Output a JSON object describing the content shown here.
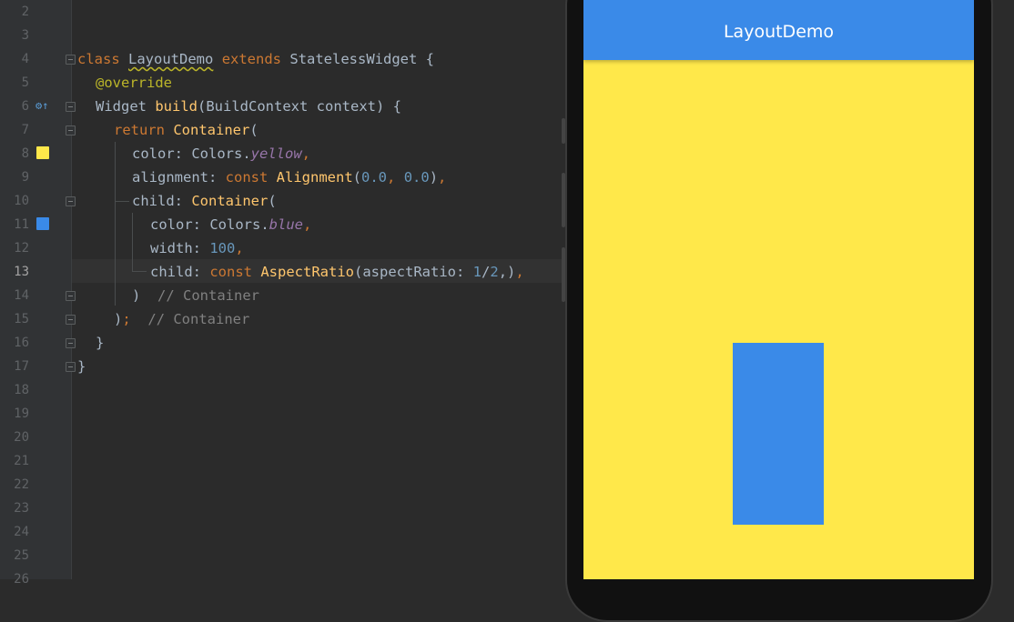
{
  "editor": {
    "line_numbers": [
      "2",
      "3",
      "4",
      "5",
      "6",
      "7",
      "8",
      "9",
      "10",
      "11",
      "12",
      "13",
      "14",
      "15",
      "16",
      "17",
      "18",
      "19",
      "20",
      "21",
      "22",
      "23",
      "24",
      "25",
      "26"
    ],
    "current_line": "13",
    "code": {
      "l4": {
        "kw_class": "class",
        "name": "LayoutDemo",
        "kw_extends": "extends",
        "base": "StatelessWidget",
        "brace": " {"
      },
      "l5": {
        "at": "@",
        "ann": "override"
      },
      "l6": {
        "type": "Widget",
        "method": "build",
        "params": "(BuildContext context) {"
      },
      "l7": {
        "kw_return": "return",
        "ctor": "Container",
        "paren": "("
      },
      "l8": {
        "prop": "color: Colors.",
        "value": "yellow",
        "comma": ","
      },
      "l9": {
        "prop": "alignment: ",
        "kw_const": "const",
        "ctor": "Alignment",
        "open": "(",
        "a": "0.0",
        "sep": ", ",
        "b": "0.0",
        "close": ")",
        "comma": ","
      },
      "l10": {
        "prop": "child: ",
        "ctor": "Container",
        "paren": "("
      },
      "l11": {
        "prop": "color: Colors.",
        "value": "blue",
        "comma": ","
      },
      "l12": {
        "prop": "width: ",
        "value": "100",
        "comma": ","
      },
      "l13": {
        "prop": "child: ",
        "kw_const": "const",
        "ctor": "AspectRatio",
        "open": "(aspectRatio: ",
        "a": "1",
        "slash": "/",
        "b": "2",
        "close": ",)",
        "comma": ","
      },
      "l14": {
        "close": ")",
        "comment": "// Container"
      },
      "l15": {
        "close": ")",
        "semi": ";",
        "comment": "// Container"
      },
      "l16": {
        "close": "}"
      },
      "l17": {
        "close": "}"
      }
    },
    "swatches": {
      "yellow": "#ffe84a",
      "blue": "#3a8ae8"
    },
    "gutter_icons": [
      "override-icon",
      "fold-icon"
    ]
  },
  "preview": {
    "app_title": "LayoutDemo",
    "app_bar_color": "#3a8ae8",
    "background_color": "#ffe84a",
    "box_color": "#3a8ae8"
  }
}
